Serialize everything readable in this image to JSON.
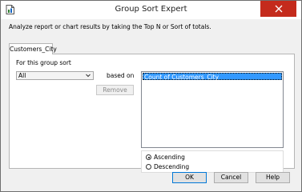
{
  "window": {
    "title": "Group Sort Expert"
  },
  "description": "Analyze report or chart results by taking the Top N or Sort of totals.",
  "tabs": [
    {
      "label": "Customers_City"
    }
  ],
  "group_sort": {
    "label": "For this group sort",
    "sort_select_value": "All",
    "based_on_label": "based on",
    "based_on_select_value": "",
    "remove_label": "Remove"
  },
  "summary_list": {
    "items": [
      "Count of Customers_City"
    ]
  },
  "order": {
    "ascending_label": "Ascending",
    "descending_label": "Descending",
    "selected": "Ascending"
  },
  "buttons": {
    "ok": "OK",
    "cancel": "Cancel",
    "help": "Help"
  },
  "colors": {
    "close": "#c42b1c",
    "selection": "#3399ff",
    "panel_bg": "#f0f0f0"
  },
  "icons": {
    "app": "report-document-icon",
    "close": "close-icon",
    "dropdown": "chevron-down-icon"
  }
}
